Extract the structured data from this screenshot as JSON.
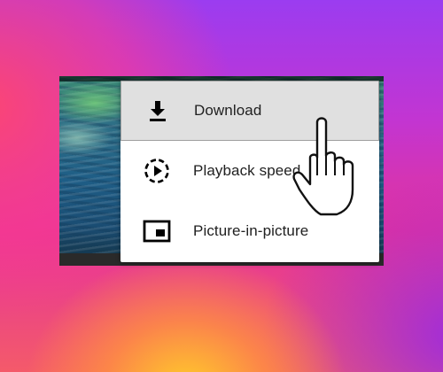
{
  "menu": {
    "items": [
      {
        "label": "Download",
        "icon": "download-icon"
      },
      {
        "label": "Playback speed",
        "icon": "playback-speed-icon"
      },
      {
        "label": "Picture-in-picture",
        "icon": "picture-in-picture-icon"
      }
    ],
    "highlighted_item": "Download"
  },
  "cursor": {
    "icon": "hand-pointer-icon"
  },
  "colors": {
    "menu_background": "#ffffff",
    "highlight_background": "#e0e0e0",
    "text": "#212121",
    "icon": "#000000"
  }
}
